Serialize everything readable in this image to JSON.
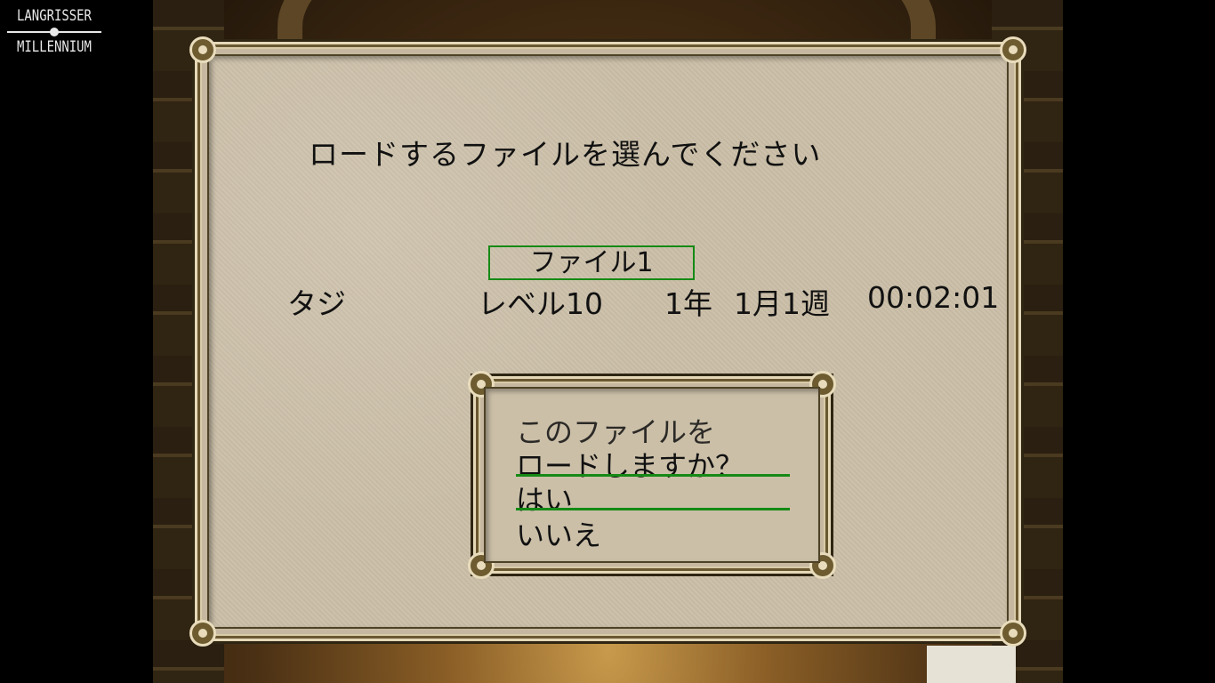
{
  "logo": {
    "line1": "LANGRISSER",
    "line2": "MILLENNIUM"
  },
  "load_screen": {
    "prompt": "ロードするファイルを選んでください",
    "slot_label": "ファイル1",
    "character_name": "タジ",
    "level": "レベル10",
    "year": "1年",
    "month_week": "1月1週",
    "play_time": "00:02:01"
  },
  "confirm_dialog": {
    "line1": "このファイルを",
    "line2": "ロードしますか？",
    "option_yes": "はい",
    "option_no": "いいえ"
  },
  "colors": {
    "selection_border": "#158a15",
    "parchment": "#cbbfa8",
    "frame_dark": "#2e2512"
  }
}
